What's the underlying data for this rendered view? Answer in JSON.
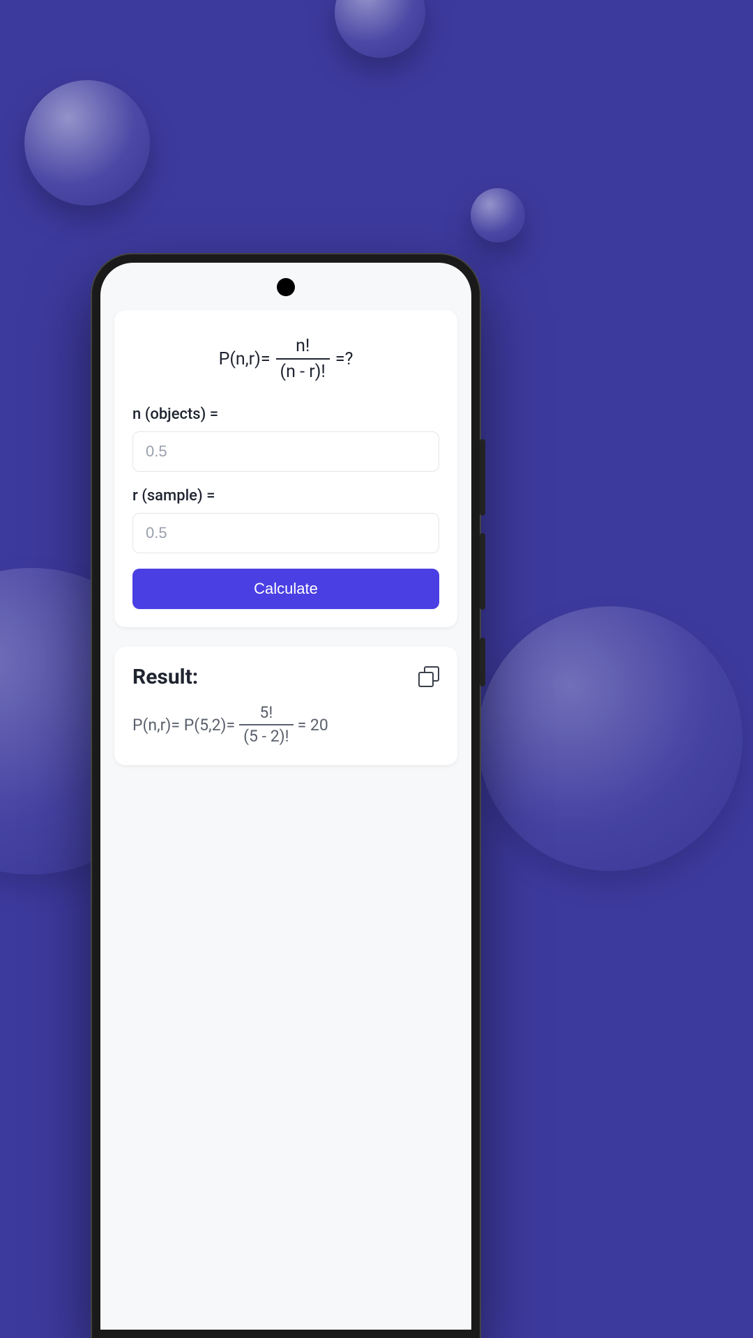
{
  "formula": {
    "lhs": "P(n,r)=",
    "numerator": "n!",
    "denominator": "(n - r)!",
    "rhs": "=?"
  },
  "inputs": {
    "n_label": "n (objects) =",
    "n_placeholder": "0.5",
    "r_label": "r (sample) =",
    "r_placeholder": "0.5"
  },
  "button": {
    "calculate": "Calculate"
  },
  "result": {
    "title": "Result:",
    "prefix": "P(n,r)= P(5,2)=",
    "numerator": "5!",
    "denominator": "(5 - 2)!",
    "equals": "= 20"
  }
}
